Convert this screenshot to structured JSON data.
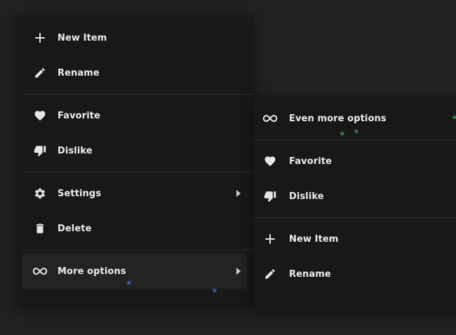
{
  "main_menu": {
    "items": [
      {
        "label": "New Item",
        "icon": "plus-icon"
      },
      {
        "label": "Rename",
        "icon": "pencil-icon"
      },
      {
        "label": "Favorite",
        "icon": "heart-icon"
      },
      {
        "label": "Dislike",
        "icon": "thumbs-down-icon"
      },
      {
        "label": "Settings",
        "icon": "gear-icon",
        "has_submenu": true
      },
      {
        "label": "Delete",
        "icon": "trash-icon"
      },
      {
        "label": "More options",
        "icon": "infinity-icon",
        "has_submenu": true,
        "active": true
      }
    ]
  },
  "sub_menu": {
    "items": [
      {
        "label": "Even more options",
        "icon": "infinity-icon"
      },
      {
        "label": "Favorite",
        "icon": "heart-icon"
      },
      {
        "label": "Dislike",
        "icon": "thumbs-down-icon"
      },
      {
        "label": "New Item",
        "icon": "plus-icon"
      },
      {
        "label": "Rename",
        "icon": "pencil-icon"
      }
    ]
  },
  "colors": {
    "background": "#212121",
    "menu_background": "#181818",
    "active_item": "#232323",
    "text": "#ececec",
    "star_blue": "#3a5fa8",
    "star_green": "#3f7a4a"
  }
}
